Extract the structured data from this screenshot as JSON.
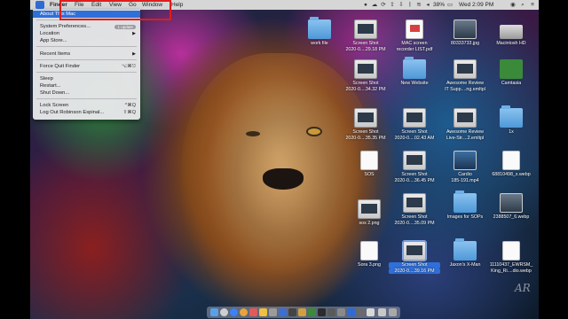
{
  "menubar": {
    "apple_glyph": "",
    "app_name": "Finder",
    "menus": [
      "File",
      "Edit",
      "View",
      "Go",
      "Window",
      "Help"
    ],
    "battery": "38%",
    "clock": "Wed 2:09 PM"
  },
  "apple_menu": {
    "about": "About This Mac",
    "system_prefs": "System Preferences...",
    "system_prefs_badge": "1 update",
    "location": "Location",
    "app_store": "App Store...",
    "recent_items": "Recent Items",
    "force_quit": "Force Quit Finder",
    "force_quit_shortcut": "⌥⌘⎋",
    "sleep": "Sleep",
    "restart": "Restart...",
    "shutdown": "Shut Down...",
    "lock_screen": "Lock Screen",
    "lock_screen_shortcut": "^⌘Q",
    "log_out": "Log Out Robinson Espinal...",
    "log_out_shortcut": "⇧⌘Q"
  },
  "desktop_icons": [
    {
      "l1": "work file",
      "l2": ""
    },
    {
      "l1": "Screen Shot",
      "l2": "2020-0....29.18 PM"
    },
    {
      "l1": "MAC screen",
      "l2": "recorder LIST.pdf"
    },
    {
      "l1": "80333733.jpg",
      "l2": ""
    },
    {
      "l1": "Macintosh HD",
      "l2": ""
    },
    {
      "l1": "Screen Shot",
      "l2": "2020-0....34.32 PM"
    },
    {
      "l1": "New Website",
      "l2": ""
    },
    {
      "l1": "Awesome Review",
      "l2": "IT Supp....ng.emltpl"
    },
    {
      "l1": "Camtasia",
      "l2": ""
    },
    {
      "l1": "Screen Shot",
      "l2": "2020-0....35.35 PM"
    },
    {
      "l1": "Screen Shot",
      "l2": "2020-0....02.43 AM"
    },
    {
      "l1": "Awesome Review",
      "l2": "Live-Str....2.emltpl"
    },
    {
      "l1": "1x",
      "l2": ""
    },
    {
      "l1": "SOS",
      "l2": ""
    },
    {
      "l1": "Screen Shot",
      "l2": "2020-0....36.45 PM"
    },
    {
      "l1": "Cardio",
      "l2": "185-191.mp4"
    },
    {
      "l1": "68810498_x.webp",
      "l2": ""
    },
    {
      "l1": "Screen Shot",
      "l2": "2020-0....35.09 PM"
    },
    {
      "l1": "Images for SOPs",
      "l2": ""
    },
    {
      "l1": "2388507_6.webp",
      "l2": ""
    },
    {
      "l1": "sos 2.png",
      "l2": ""
    },
    {
      "l1": "Sora 3.png",
      "l2": ""
    },
    {
      "l1": "Screen Shot",
      "l2": "2020-0....39.16 PM"
    },
    {
      "l1": "Jaxon's X-Man",
      "l2": ""
    },
    {
      "l1": "11110437_EWRSM_",
      "l2": "King_Ri....dio.webp"
    }
  ],
  "colors": {
    "highlight": "#e11c1c",
    "selection": "#2f6fd9",
    "menu_bg": "#e8e8ea"
  }
}
